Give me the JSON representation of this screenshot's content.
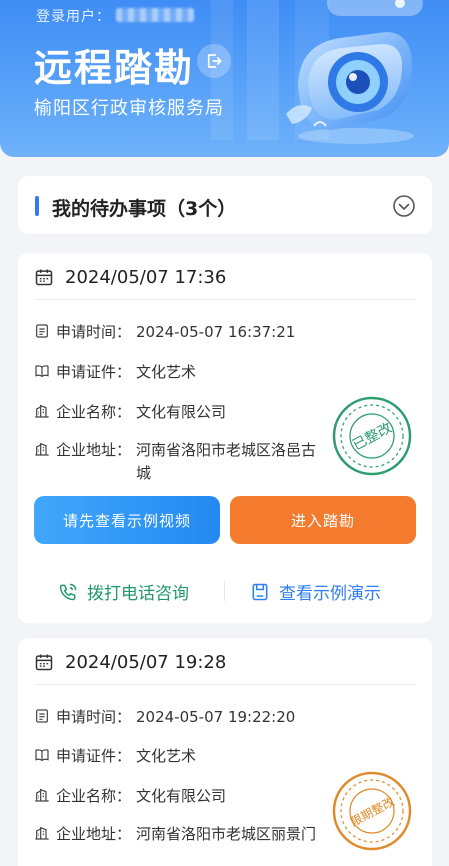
{
  "header": {
    "login_label": "登录用户：",
    "title": "远程踏勘",
    "subtitle": "榆阳区行政审核服务局"
  },
  "todo": {
    "title": "我的待办事项（3个）"
  },
  "labels": {
    "apply_time": "申请时间：",
    "apply_cert": "申请证件：",
    "company_name": "企业名称：",
    "company_addr": "企业地址："
  },
  "items": [
    {
      "datetime": "2024/05/07 17:36",
      "apply_time": "2024-05-07 16:37:21",
      "cert": "文化艺术",
      "company": "文化有限公司",
      "address": "河南省洛阳市老城区洛邑古城",
      "stamp": "已整改",
      "stamp_color": "#2e9c6f",
      "video_button": "请先查看示例视频",
      "enter_button": "进入踏勘",
      "call_action": "拨打电话咨询",
      "demo_action": "查看示例演示"
    },
    {
      "datetime": "2024/05/07 19:28",
      "apply_time": "2024-05-07 19:22:20",
      "cert": "文化艺术",
      "company": "文化有限公司",
      "address": "河南省洛阳市老城区丽景门",
      "stamp": "限期整改",
      "stamp_color": "#e0892a"
    }
  ],
  "colors": {
    "primary": "#3478f6",
    "orange": "#f47a2e",
    "green": "#1f9a68"
  }
}
